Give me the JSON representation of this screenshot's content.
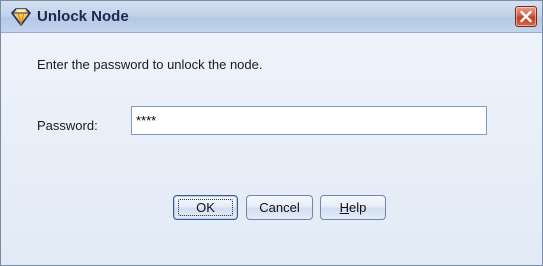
{
  "window": {
    "title": "Unlock Node",
    "app_icon": "diamond-node-icon",
    "close_icon": "close-icon"
  },
  "dialog": {
    "prompt": "Enter the password to unlock the node.",
    "password_label": "Password:",
    "password_value": "****"
  },
  "buttons": {
    "ok": "OK",
    "cancel": "Cancel",
    "help_mnemonic": "H",
    "help_rest": "elp"
  },
  "colors": {
    "titlebar": "#c3d3ea",
    "client_background": "#e8eef8",
    "close_button": "#d4553c",
    "input_border": "#7f9db9"
  }
}
